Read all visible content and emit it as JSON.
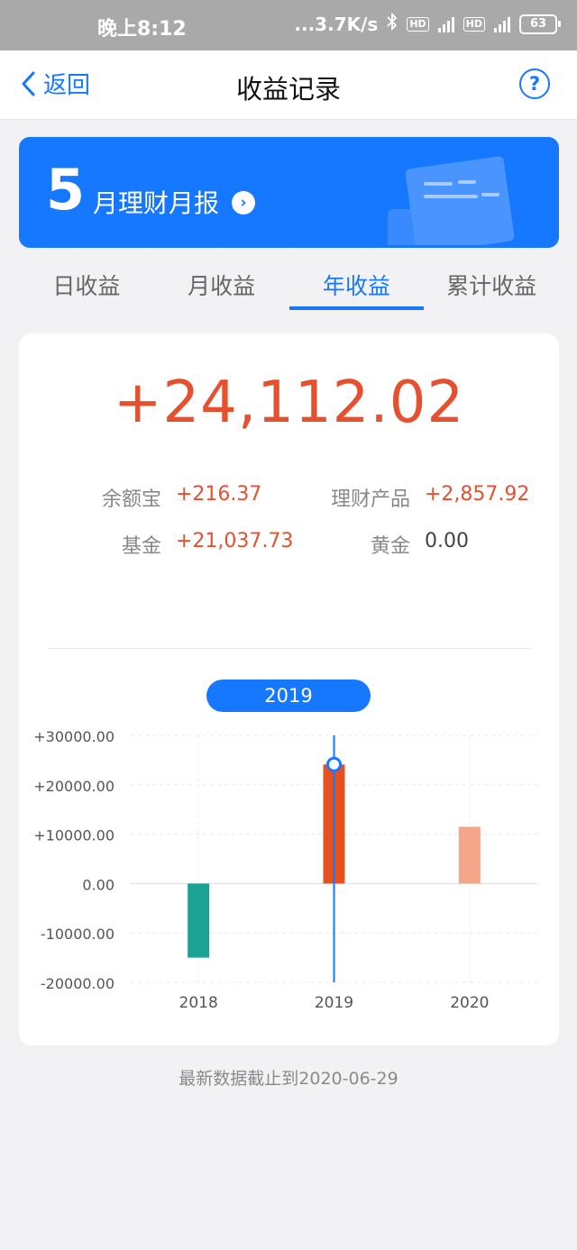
{
  "status_bar": {
    "time": "晚上8:12",
    "network_speed": "...3.7K/s",
    "battery": "63"
  },
  "nav": {
    "back_label": "返回",
    "title": "收益记录",
    "help_label": "?"
  },
  "banner": {
    "month_number": "5",
    "label": "月理财月报"
  },
  "tabs": [
    {
      "label": "日收益",
      "active": false
    },
    {
      "label": "月收益",
      "active": false
    },
    {
      "label": "年收益",
      "active": true
    },
    {
      "label": "累计收益",
      "active": false
    }
  ],
  "summary": {
    "total": "+24,112.02",
    "items": [
      {
        "label": "余额宝",
        "value": "+216.37"
      },
      {
        "label": "理财产品",
        "value": "+2,857.92"
      },
      {
        "label": "基金",
        "value": "+21,037.73"
      },
      {
        "label": "黄金",
        "value": "0.00"
      }
    ]
  },
  "selected_year": "2019",
  "chart_data": {
    "type": "bar",
    "categories": [
      "2018",
      "2019",
      "2020"
    ],
    "values": [
      -15000,
      24112.02,
      11500
    ],
    "colors": [
      "#1aa393",
      "#e8511e",
      "#f5a58a"
    ],
    "selected_index": 1,
    "ylim": [
      -20000,
      30000
    ],
    "yticks": [
      "+30000.00",
      "+20000.00",
      "+10000.00",
      "0.00",
      "-10000.00",
      "-20000.00"
    ],
    "ytick_values": [
      30000,
      20000,
      10000,
      0,
      -10000,
      -20000
    ],
    "title": "",
    "xlabel": "",
    "ylabel": "",
    "grid": true
  },
  "footnote": "最新数据截止到2020-06-29"
}
